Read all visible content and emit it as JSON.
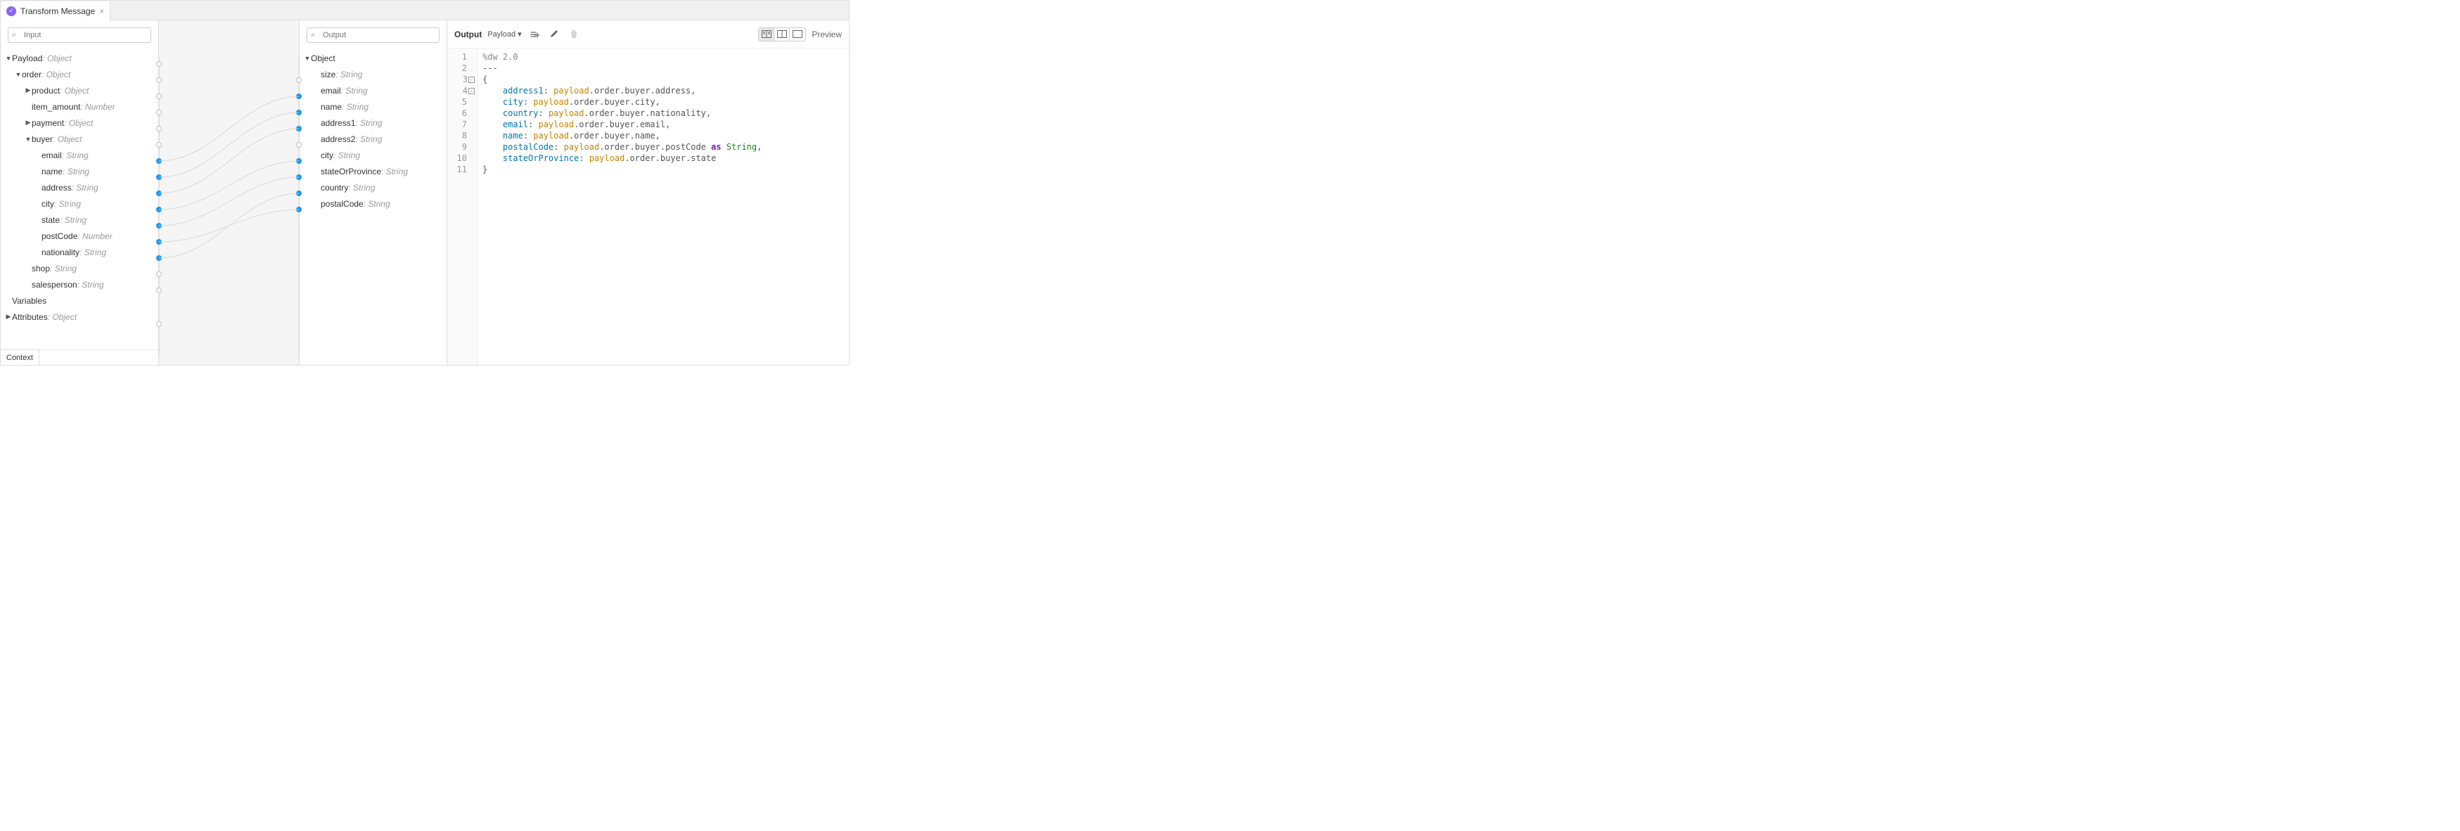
{
  "tab": {
    "title": "Transform Message",
    "icon_name": "transform-icon"
  },
  "input_panel": {
    "search_placeholder": "Input",
    "tree": [
      {
        "id": "payload",
        "label": "Payload",
        "type": "Object",
        "indent": 0,
        "caret": "down",
        "dot": "open",
        "dotY": 62
      },
      {
        "id": "order",
        "label": "order",
        "type": "Object",
        "indent": 1,
        "caret": "down",
        "dot": "open",
        "dotY": 85
      },
      {
        "id": "product",
        "label": "product",
        "type": "Object",
        "indent": 2,
        "caret": "right",
        "dot": "open",
        "dotY": 108
      },
      {
        "id": "item_amount",
        "label": "item_amount",
        "type": "Number",
        "indent": 2,
        "caret": "none",
        "dot": "open",
        "dotY": 131
      },
      {
        "id": "payment",
        "label": "payment",
        "type": "Object",
        "indent": 2,
        "caret": "right",
        "dot": "open",
        "dotY": 154
      },
      {
        "id": "buyer",
        "label": "buyer",
        "type": "Object",
        "indent": 2,
        "caret": "down",
        "dot": "open",
        "dotY": 177
      },
      {
        "id": "email",
        "label": "email",
        "type": "String",
        "indent": 3,
        "caret": "none",
        "dot": "filled",
        "dotY": 200
      },
      {
        "id": "name",
        "label": "name",
        "type": "String",
        "indent": 3,
        "caret": "none",
        "dot": "filled",
        "dotY": 223
      },
      {
        "id": "address",
        "label": "address",
        "type": "String",
        "indent": 3,
        "caret": "none",
        "dot": "filled",
        "dotY": 246
      },
      {
        "id": "city",
        "label": "city",
        "type": "String",
        "indent": 3,
        "caret": "none",
        "dot": "filled",
        "dotY": 269
      },
      {
        "id": "state",
        "label": "state",
        "type": "String",
        "indent": 3,
        "caret": "none",
        "dot": "filled",
        "dotY": 292
      },
      {
        "id": "postCode",
        "label": "postCode",
        "type": "Number",
        "indent": 3,
        "caret": "none",
        "dot": "filled",
        "dotY": 315
      },
      {
        "id": "nationality",
        "label": "nationality",
        "type": "String",
        "indent": 3,
        "caret": "none",
        "dot": "filled",
        "dotY": 338
      },
      {
        "id": "shop",
        "label": "shop",
        "type": "String",
        "indent": 2,
        "caret": "none",
        "dot": "open",
        "dotY": 361
      },
      {
        "id": "salesperson",
        "label": "salesperson",
        "type": "String",
        "indent": 2,
        "caret": "none",
        "dot": "open",
        "dotY": 384
      },
      {
        "id": "variables",
        "label": "Variables",
        "type": "",
        "indent": 0,
        "caret": "none",
        "dot": "none"
      },
      {
        "id": "attributes",
        "label": "Attributes",
        "type": "Object",
        "indent": 0,
        "caret": "right",
        "dot": "open",
        "dotY": 432
      }
    ],
    "context_label": "Context"
  },
  "output_panel": {
    "search_placeholder": "Output",
    "tree": [
      {
        "id": "object",
        "label": "Object",
        "type": "",
        "indent": 0,
        "caret": "down",
        "dot": "none"
      },
      {
        "id": "size",
        "label": "size",
        "type": "String",
        "indent": 1,
        "caret": "none",
        "dot": "open",
        "dotY": 85
      },
      {
        "id": "email_o",
        "label": "email",
        "type": "String",
        "indent": 1,
        "caret": "none",
        "dot": "filled",
        "dotY": 108
      },
      {
        "id": "name_o",
        "label": "name",
        "type": "String",
        "indent": 1,
        "caret": "none",
        "dot": "filled",
        "dotY": 131
      },
      {
        "id": "address1",
        "label": "address1",
        "type": "String",
        "indent": 1,
        "caret": "none",
        "dot": "filled",
        "dotY": 154
      },
      {
        "id": "address2",
        "label": "address2",
        "type": "String",
        "indent": 1,
        "caret": "none",
        "dot": "open",
        "dotY": 177
      },
      {
        "id": "city_o",
        "label": "city",
        "type": "String",
        "indent": 1,
        "caret": "none",
        "dot": "filled",
        "dotY": 200
      },
      {
        "id": "stateOrProvince",
        "label": "stateOrProvince",
        "type": "String",
        "indent": 1,
        "caret": "none",
        "dot": "filled",
        "dotY": 223
      },
      {
        "id": "country",
        "label": "country",
        "type": "String",
        "indent": 1,
        "caret": "none",
        "dot": "filled",
        "dotY": 246
      },
      {
        "id": "postalCode",
        "label": "postalCode",
        "type": "String",
        "indent": 1,
        "caret": "none",
        "dot": "filled",
        "dotY": 269
      }
    ]
  },
  "mapping_wires": [
    {
      "fromY": 200,
      "toY": 108
    },
    {
      "fromY": 223,
      "toY": 131
    },
    {
      "fromY": 246,
      "toY": 154
    },
    {
      "fromY": 269,
      "toY": 200
    },
    {
      "fromY": 292,
      "toY": 223
    },
    {
      "fromY": 315,
      "toY": 269
    },
    {
      "fromY": 338,
      "toY": 246
    }
  ],
  "code_panel": {
    "output_label": "Output",
    "target_dropdown": "Payload",
    "preview_label": "Preview",
    "lines": [
      {
        "n": 1,
        "fold": false,
        "tokens": [
          {
            "t": "%dw 2.0",
            "c": "tok-dir"
          }
        ]
      },
      {
        "n": 2,
        "fold": false,
        "tokens": [
          {
            "t": "---",
            "c": "tok-punc"
          }
        ]
      },
      {
        "n": 3,
        "fold": true,
        "tokens": [
          {
            "t": "{",
            "c": "tok-punc"
          }
        ]
      },
      {
        "n": 4,
        "fold": true,
        "tokens": [
          {
            "t": "    ",
            "c": ""
          },
          {
            "t": "address1",
            "c": "tok-key"
          },
          {
            "t": ": ",
            "c": "tok-punc"
          },
          {
            "t": "payload",
            "c": "tok-ident"
          },
          {
            "t": ".order.buyer.address,",
            "c": "tok-punc"
          }
        ]
      },
      {
        "n": 5,
        "fold": false,
        "tokens": [
          {
            "t": "    ",
            "c": ""
          },
          {
            "t": "city",
            "c": "tok-key"
          },
          {
            "t": ": ",
            "c": "tok-punc"
          },
          {
            "t": "payload",
            "c": "tok-ident"
          },
          {
            "t": ".order.buyer.city,",
            "c": "tok-punc"
          }
        ]
      },
      {
        "n": 6,
        "fold": false,
        "tokens": [
          {
            "t": "    ",
            "c": ""
          },
          {
            "t": "country",
            "c": "tok-key"
          },
          {
            "t": ": ",
            "c": "tok-punc"
          },
          {
            "t": "payload",
            "c": "tok-ident"
          },
          {
            "t": ".order.buyer.nationality,",
            "c": "tok-punc"
          }
        ]
      },
      {
        "n": 7,
        "fold": false,
        "tokens": [
          {
            "t": "    ",
            "c": ""
          },
          {
            "t": "email",
            "c": "tok-key"
          },
          {
            "t": ": ",
            "c": "tok-punc"
          },
          {
            "t": "payload",
            "c": "tok-ident"
          },
          {
            "t": ".order.buyer.email,",
            "c": "tok-punc"
          }
        ]
      },
      {
        "n": 8,
        "fold": false,
        "tokens": [
          {
            "t": "    ",
            "c": ""
          },
          {
            "t": "name",
            "c": "tok-key"
          },
          {
            "t": ": ",
            "c": "tok-punc"
          },
          {
            "t": "payload",
            "c": "tok-ident"
          },
          {
            "t": ".order.buyer.name,",
            "c": "tok-punc"
          }
        ]
      },
      {
        "n": 9,
        "fold": false,
        "tokens": [
          {
            "t": "    ",
            "c": ""
          },
          {
            "t": "postalCode",
            "c": "tok-key"
          },
          {
            "t": ": ",
            "c": "tok-punc"
          },
          {
            "t": "payload",
            "c": "tok-ident"
          },
          {
            "t": ".order.buyer.postCode ",
            "c": "tok-punc"
          },
          {
            "t": "as",
            "c": "tok-kw"
          },
          {
            "t": " ",
            "c": ""
          },
          {
            "t": "String",
            "c": "tok-type"
          },
          {
            "t": ",",
            "c": "tok-punc"
          }
        ]
      },
      {
        "n": 10,
        "fold": false,
        "tokens": [
          {
            "t": "    ",
            "c": ""
          },
          {
            "t": "stateOrProvince",
            "c": "tok-key"
          },
          {
            "t": ": ",
            "c": "tok-punc"
          },
          {
            "t": "payload",
            "c": "tok-ident"
          },
          {
            "t": ".order.buyer.state",
            "c": "tok-punc"
          }
        ]
      },
      {
        "n": 11,
        "fold": false,
        "tokens": [
          {
            "t": "}",
            "c": "tok-punc"
          }
        ]
      }
    ]
  }
}
